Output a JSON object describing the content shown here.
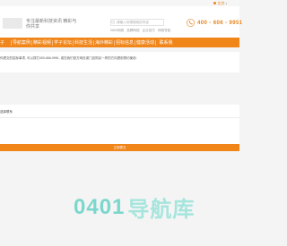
{
  "topbar": {
    "location": "北京"
  },
  "header": {
    "slogan": "专注最新科技资讯 精彩与你共享",
    "search_placeholder": "请输入你想搜索的内容",
    "hot_words": [
      "0800网络",
      "品牌网络",
      "企业官方",
      "网络导航"
    ],
    "phone": "400 - 606 - 9951"
  },
  "nav": {
    "items": [
      "子",
      "导航案例",
      "精彩视频",
      "学子论坛",
      "科技生活",
      "海外精彩",
      "招标信息",
      "健康活动",
      "联系我"
    ]
  },
  "notice": {
    "text": "你提交的招标事项, 可以拨打400-666-9951, 或在我们官方网页或门店购买一样的方向提前预约使用."
  },
  "form": {
    "title": "选择联系",
    "submit_label": "立即提交"
  },
  "watermark": {
    "number": "0401",
    "text": "导航库"
  },
  "colors": {
    "accent": "#f08519",
    "watermark": "#7bd7cc"
  }
}
